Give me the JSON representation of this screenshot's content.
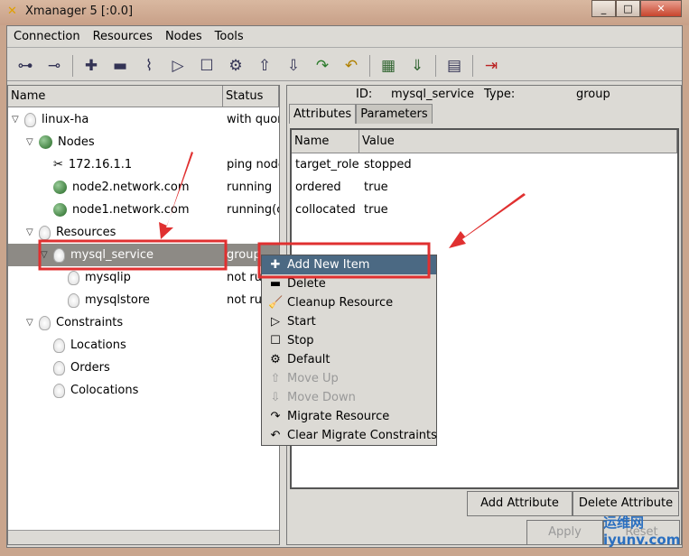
{
  "window": {
    "title": "Xmanager 5 [:0.0]",
    "controls": [
      "_",
      "□",
      "✕"
    ]
  },
  "menubar": [
    "Connection",
    "Resources",
    "Nodes",
    "Tools"
  ],
  "toolbar": [
    "connect-icon",
    "disconnect-icon",
    "add-icon",
    "remove-icon",
    "cleanup-icon",
    "start-icon",
    "stop-icon",
    "default-icon",
    "move-up-icon",
    "move-down-icon",
    "migrate-icon",
    "clear-migrate-icon",
    "standby-icon",
    "active-icon",
    "log-icon",
    "exit-icon"
  ],
  "tree": {
    "headers": [
      "Name",
      "Status"
    ],
    "rows": [
      {
        "name": "linux-ha",
        "status": "with quor",
        "level": 0,
        "icon": "bulb",
        "expanded": true
      },
      {
        "name": "Nodes",
        "status": "",
        "level": 1,
        "icon": "ball",
        "expanded": true
      },
      {
        "name": "172.16.1.1",
        "status": "ping node",
        "level": 2,
        "icon": "tools"
      },
      {
        "name": "node2.network.com",
        "status": "running",
        "level": 2,
        "icon": "ball"
      },
      {
        "name": "node1.network.com",
        "status": "running(c",
        "level": 2,
        "icon": "ball"
      },
      {
        "name": "Resources",
        "status": "",
        "level": 1,
        "icon": "bulb",
        "expanded": true
      },
      {
        "name": "mysql_service",
        "status": "group",
        "level": 2,
        "icon": "bulb",
        "expanded": true,
        "selected": true
      },
      {
        "name": "mysqlip",
        "status": "not ru",
        "level": 3,
        "icon": "bulb"
      },
      {
        "name": "mysqlstore",
        "status": "not ru",
        "level": 3,
        "icon": "bulb"
      },
      {
        "name": "Constraints",
        "status": "",
        "level": 1,
        "icon": "bulb",
        "expanded": true
      },
      {
        "name": "Locations",
        "status": "",
        "level": 2,
        "icon": "bulb"
      },
      {
        "name": "Orders",
        "status": "",
        "level": 2,
        "icon": "bulb"
      },
      {
        "name": "Colocations",
        "status": "",
        "level": 2,
        "icon": "bulb"
      }
    ]
  },
  "detail": {
    "id_label": "ID:",
    "id": "mysql_service",
    "type_label": "Type:",
    "type": "group",
    "tabs": [
      "Attributes",
      "Parameters"
    ],
    "headers": [
      "Name",
      "Value"
    ],
    "rows": [
      [
        "target_role",
        "stopped"
      ],
      [
        "ordered",
        "true"
      ],
      [
        "collocated",
        "true"
      ]
    ],
    "add_attribute": "Add Attribute",
    "delete_attribute": "Delete Attribute",
    "apply": "Apply",
    "reset": "Reset"
  },
  "context_menu": [
    {
      "label": "Add New Item",
      "icon": "✚",
      "highlighted": true
    },
    {
      "label": "Delete",
      "icon": "▬"
    },
    {
      "label": "Cleanup Resource",
      "icon": "🧹"
    },
    {
      "label": "Start",
      "icon": "▷"
    },
    {
      "label": "Stop",
      "icon": "☐"
    },
    {
      "label": "Default",
      "icon": "⚙"
    },
    {
      "label": "Move Up",
      "icon": "⇧",
      "disabled": true
    },
    {
      "label": "Move Down",
      "icon": "⇩",
      "disabled": true
    },
    {
      "label": "Migrate Resource",
      "icon": "↷"
    },
    {
      "label": "Clear Migrate Constraints",
      "icon": "↶"
    }
  ],
  "watermark": "运维网 iyunv.com",
  "colors": {
    "highlight": "#4b6983",
    "annotation": "#e03030",
    "selection": "#8d8a85"
  }
}
